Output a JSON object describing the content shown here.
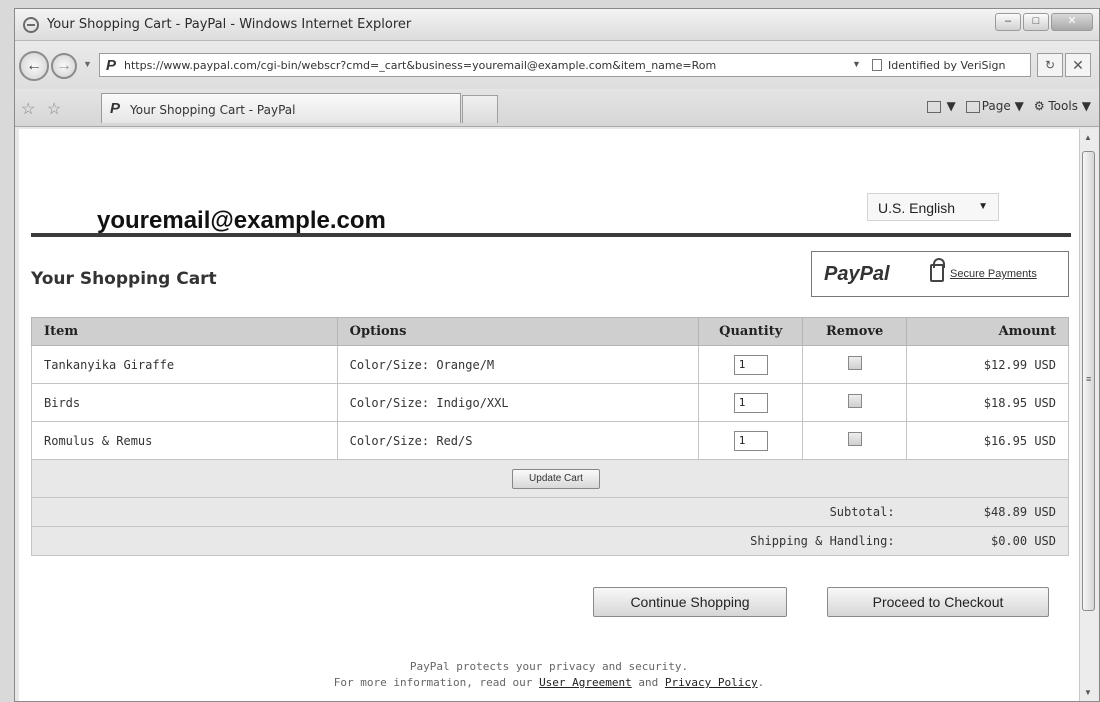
{
  "browser": {
    "window_title": "Your Shopping Cart - PayPal - Windows Internet Explorer",
    "url": "https://www.paypal.com/cgi-bin/webscr?cmd=_cart&business=youremail@example.com&item_name=Rom",
    "security_label": "Identified by VeriSign",
    "tab_label": "Your Shopping Cart - PayPal",
    "page_menu": "Page",
    "tools_menu": "Tools"
  },
  "page": {
    "merchant_email": "youremail@example.com",
    "language": "U.S. English",
    "cart_title": "Your Shopping Cart",
    "paypal_logo": "PayPal",
    "secure_payments": "Secure Payments",
    "columns": {
      "item": "Item",
      "options": "Options",
      "quantity": "Quantity",
      "remove": "Remove",
      "amount": "Amount"
    },
    "rows": [
      {
        "item": "Tankanyika Giraffe",
        "options": "Color/Size: Orange/M",
        "quantity": "1",
        "amount": "$12.99 USD"
      },
      {
        "item": "Birds",
        "options": "Color/Size: Indigo/XXL",
        "quantity": "1",
        "amount": "$18.95 USD"
      },
      {
        "item": "Romulus & Remus",
        "options": "Color/Size: Red/S",
        "quantity": "1",
        "amount": "$16.95 USD"
      }
    ],
    "update_cart": "Update Cart",
    "subtotal_label": "Subtotal:",
    "subtotal_value": "$48.89 USD",
    "shipping_label": "Shipping & Handling:",
    "shipping_value": "$0.00 USD",
    "continue_shopping": "Continue Shopping",
    "proceed_checkout": "Proceed to Checkout",
    "footer_line1": "PayPal protects your privacy and security.",
    "footer_line2_prefix": "For more information, read our",
    "user_agreement": "User Agreement",
    "footer_and": "and",
    "privacy_policy": "Privacy Policy",
    "footer_period": "."
  }
}
